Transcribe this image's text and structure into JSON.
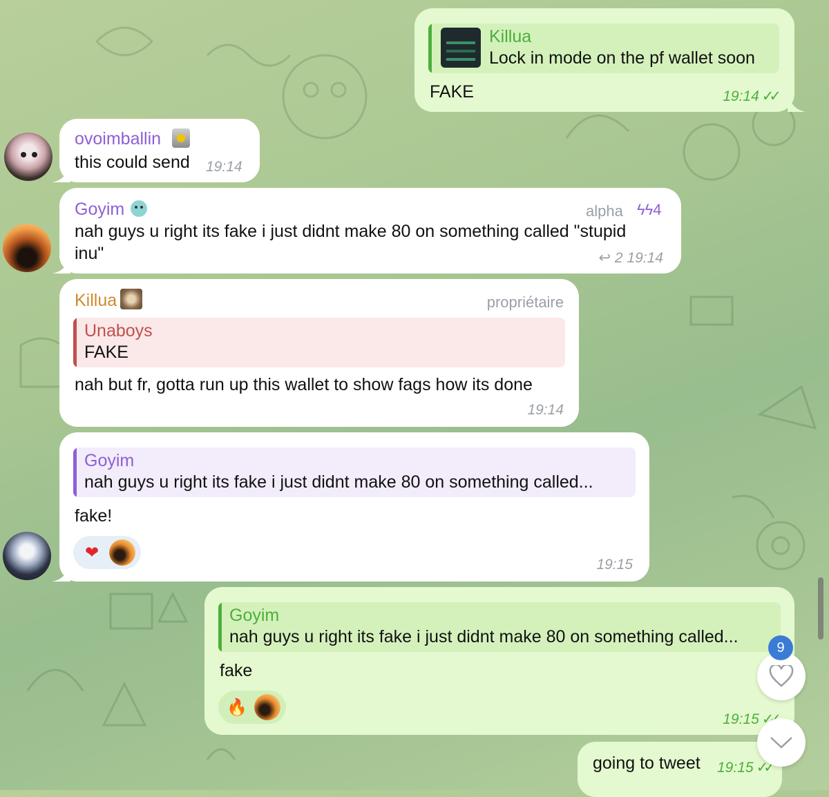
{
  "colors": {
    "incoming_bubble": "#ffffff",
    "outgoing_bubble": "#e4f9cf",
    "green_accent": "#4caf3a",
    "purple_name": "#8e5fd6",
    "orange_name": "#d08a2e",
    "red_name": "#c0504d",
    "badge_blue": "#3a7bd5"
  },
  "messages": [
    {
      "id": "m1",
      "direction": "out",
      "quote": {
        "name": "Killua",
        "text": "Lock in mode on the pf wallet soon",
        "has_thumbnail": true
      },
      "text": "FAKE",
      "time": "19:14",
      "read": true
    },
    {
      "id": "m2",
      "direction": "in",
      "sender": "ovoimballin",
      "sender_icon": "emoji-badge-icon",
      "text": "this could send",
      "time": "19:14"
    },
    {
      "id": "m3",
      "direction": "in",
      "sender": "Goyim",
      "sender_icon": "emoji-badge-icon",
      "tag": "alpha",
      "boost_count": "4",
      "text_line1": "nah guys u right its fake i just didnt make 80 on something called \"stupid",
      "text_line2": "inu\"",
      "replies": "2",
      "time": "19:14"
    },
    {
      "id": "m4",
      "direction": "in",
      "sender": "Killua",
      "sender_icon": "monkey-emoji-icon",
      "tag": "propriétaire",
      "quote": {
        "name": "Unaboys",
        "text": "FAKE"
      },
      "text": "nah but fr, gotta run up this wallet to show fags how its done",
      "time": "19:14"
    },
    {
      "id": "m5",
      "direction": "in",
      "quote": {
        "name": "Goyim",
        "text": "nah guys u right its fake i just didnt make 80 on something called..."
      },
      "text": "fake!",
      "reactions": [
        "heart-emoji",
        "avatar"
      ],
      "time": "19:15"
    },
    {
      "id": "m6",
      "direction": "out",
      "quote": {
        "name": "Goyim",
        "text": "nah guys u right its fake i just didnt make 80 on something called..."
      },
      "text": "fake",
      "reactions": [
        "fire-emoji",
        "avatar"
      ],
      "time": "19:15",
      "read": true
    },
    {
      "id": "m7",
      "direction": "out",
      "text": "going to tweet",
      "time": "19:15",
      "read": true
    }
  ],
  "floating": {
    "unread_reactions_badge": "9",
    "reaction_button_icon": "heart-outline-icon",
    "scroll_down_icon": "chevron-down-icon"
  }
}
